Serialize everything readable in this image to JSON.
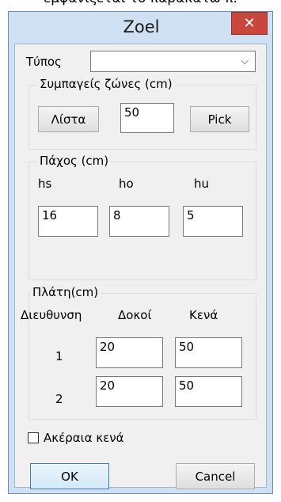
{
  "top_caption": "εμφανιζεται το παρακάτω π.",
  "window": {
    "title": "Zoel",
    "close_glyph": "✕"
  },
  "type_field": {
    "label": "Τύπος",
    "value": "",
    "chevron": "⌵"
  },
  "group_slabs": {
    "title": "Συμπαγείς ζώνες (cm)",
    "list_button": "Λίστα",
    "value": "50",
    "pick_button": "Pick"
  },
  "group_thickness": {
    "title": "Πάχος (cm)",
    "headers": [
      "hs",
      "ho",
      "hu"
    ],
    "values": [
      "16",
      "8",
      "5"
    ]
  },
  "group_widths": {
    "title": "Πλάτη(cm)",
    "headers": [
      "Διευθυνση",
      "Δοκοί",
      "Κενά"
    ],
    "rows": [
      {
        "dir": "1",
        "beams": "20",
        "gaps": "50"
      },
      {
        "dir": "2",
        "beams": "20",
        "gaps": "50"
      }
    ]
  },
  "integer_gaps": {
    "label": "Ακέραια κενά",
    "checked": false
  },
  "buttons": {
    "ok": "OK",
    "cancel": "Cancel"
  }
}
